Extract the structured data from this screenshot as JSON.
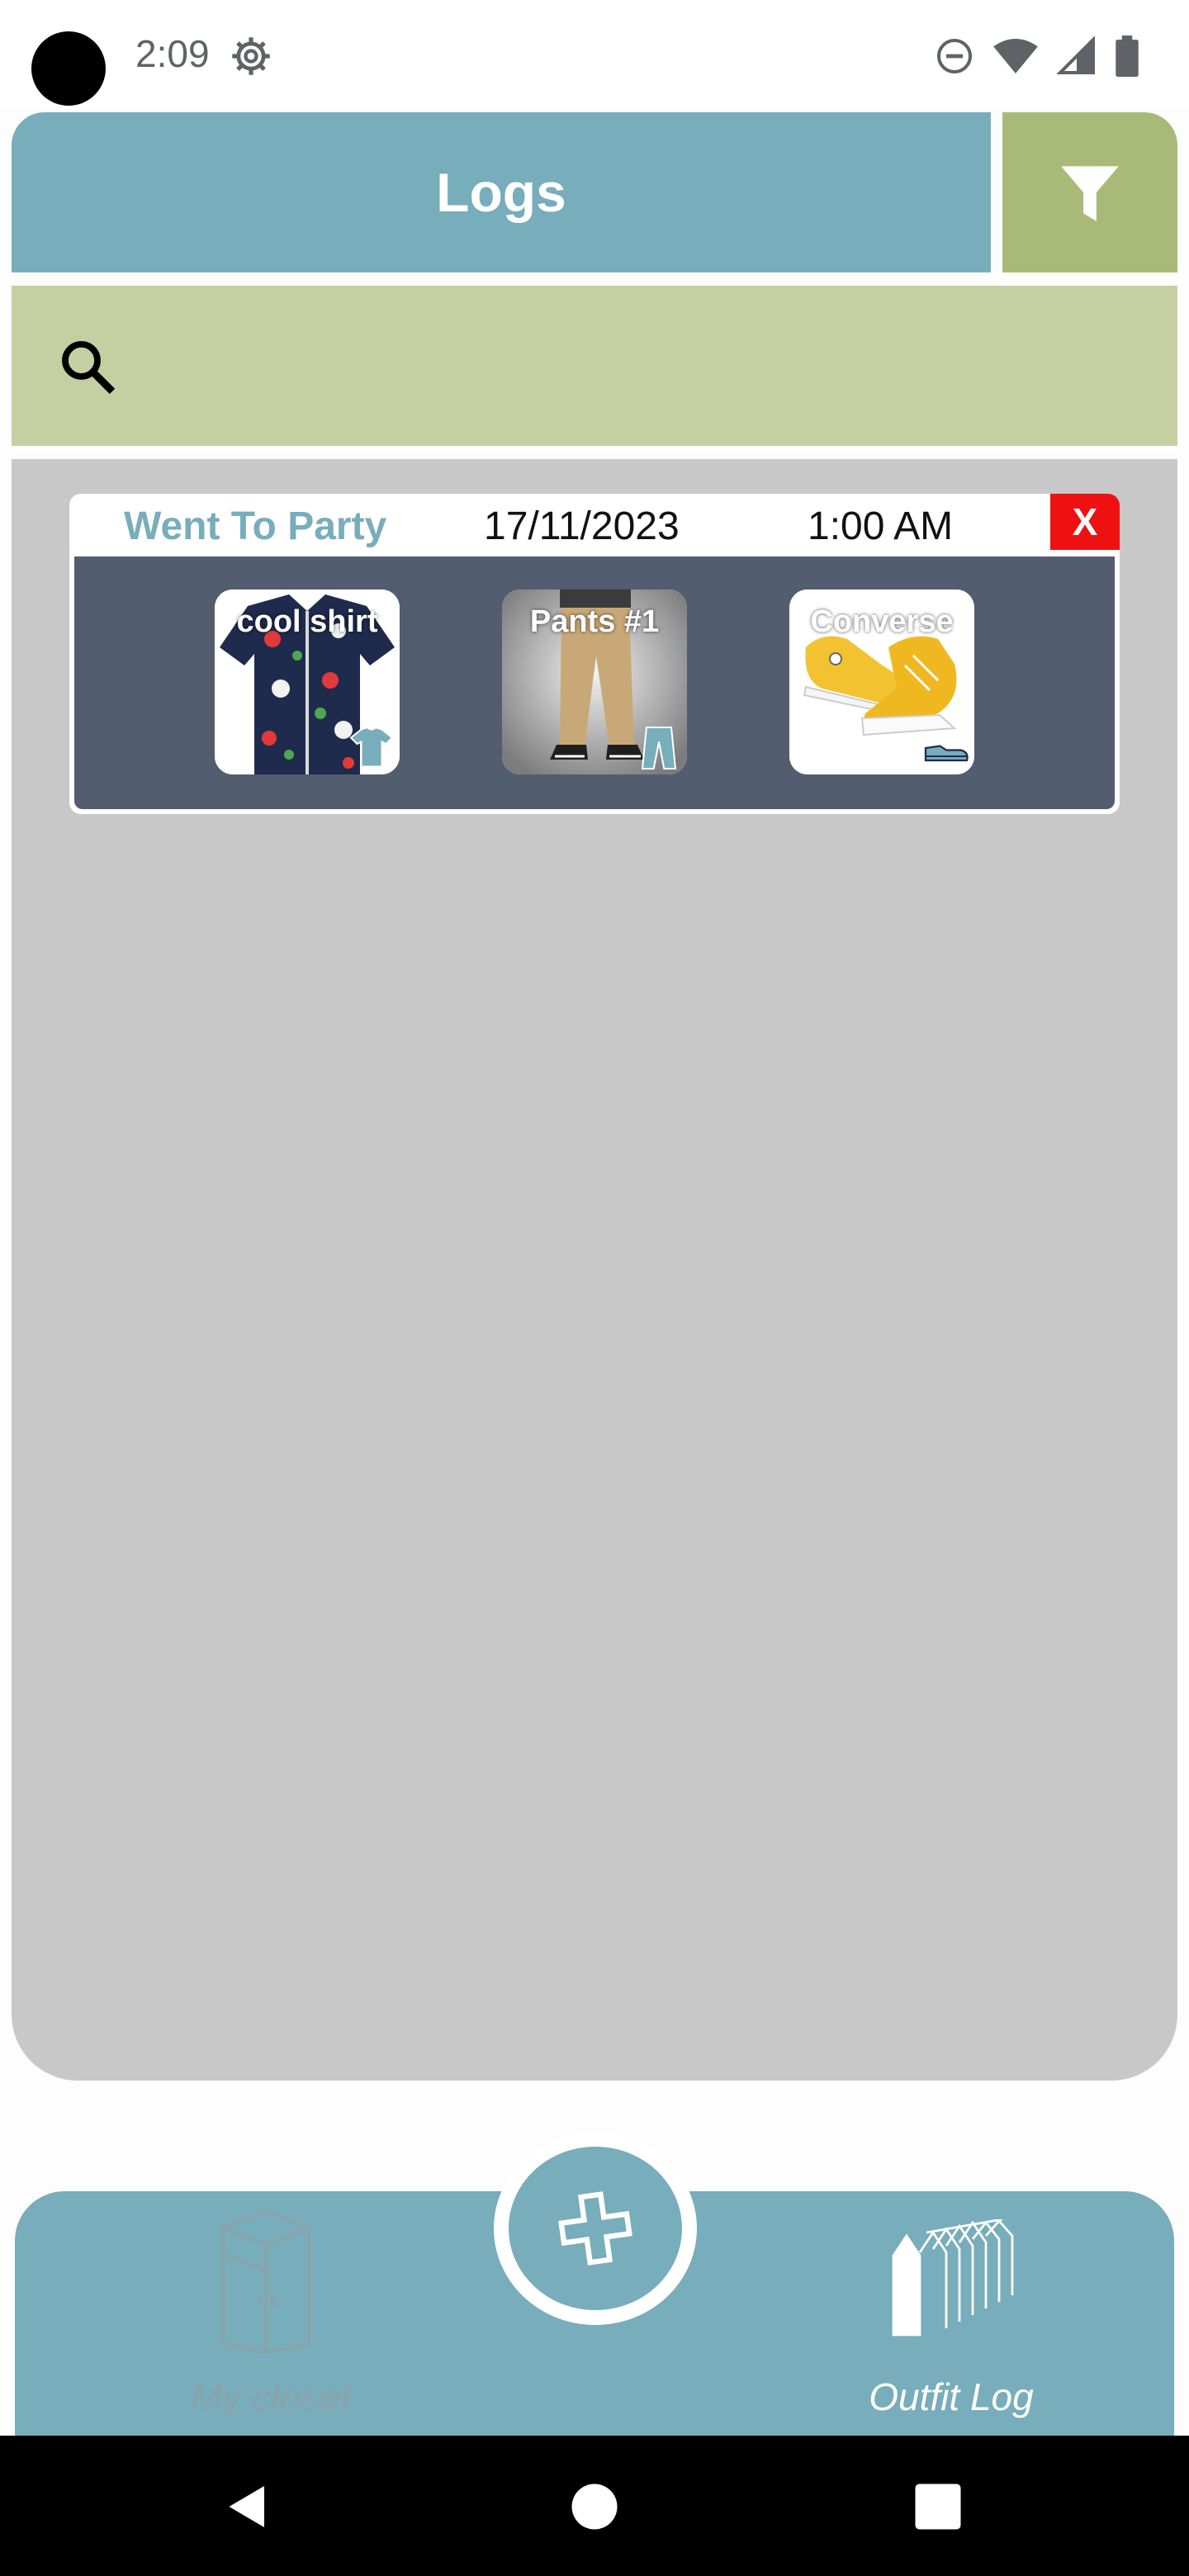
{
  "status_bar": {
    "time": "2:09",
    "icons": [
      "settings-gear-icon",
      "do-not-disturb-icon",
      "wifi-icon",
      "signal-icon",
      "battery-icon"
    ]
  },
  "header": {
    "title": "Logs",
    "filter_icon": "filter-funnel-icon"
  },
  "search": {
    "placeholder": "",
    "value": "",
    "icon": "search-icon"
  },
  "logs": [
    {
      "title": "Went To Party",
      "date": "17/11/2023",
      "time": "1:00 AM",
      "delete_label": "X",
      "items": [
        {
          "label": "cool shirt",
          "category_icon": "shirt-icon"
        },
        {
          "label": "Pants #1",
          "category_icon": "pants-icon"
        },
        {
          "label": "Converse",
          "category_icon": "shoe-icon"
        }
      ]
    }
  ],
  "bottom_nav": {
    "items": [
      {
        "label": "My closet",
        "icon": "closet-icon",
        "active": false
      },
      {
        "label": "Outfit Log",
        "icon": "clothes-rack-icon",
        "active": true
      }
    ],
    "fab_icon": "plus-icon"
  },
  "colors": {
    "primary": "#78adbb",
    "accent_green": "#a9ba78",
    "search_bg": "#c5d0a2",
    "card_body": "#525d70",
    "delete": "#ee1111",
    "content_bg": "#c8c8c8"
  }
}
